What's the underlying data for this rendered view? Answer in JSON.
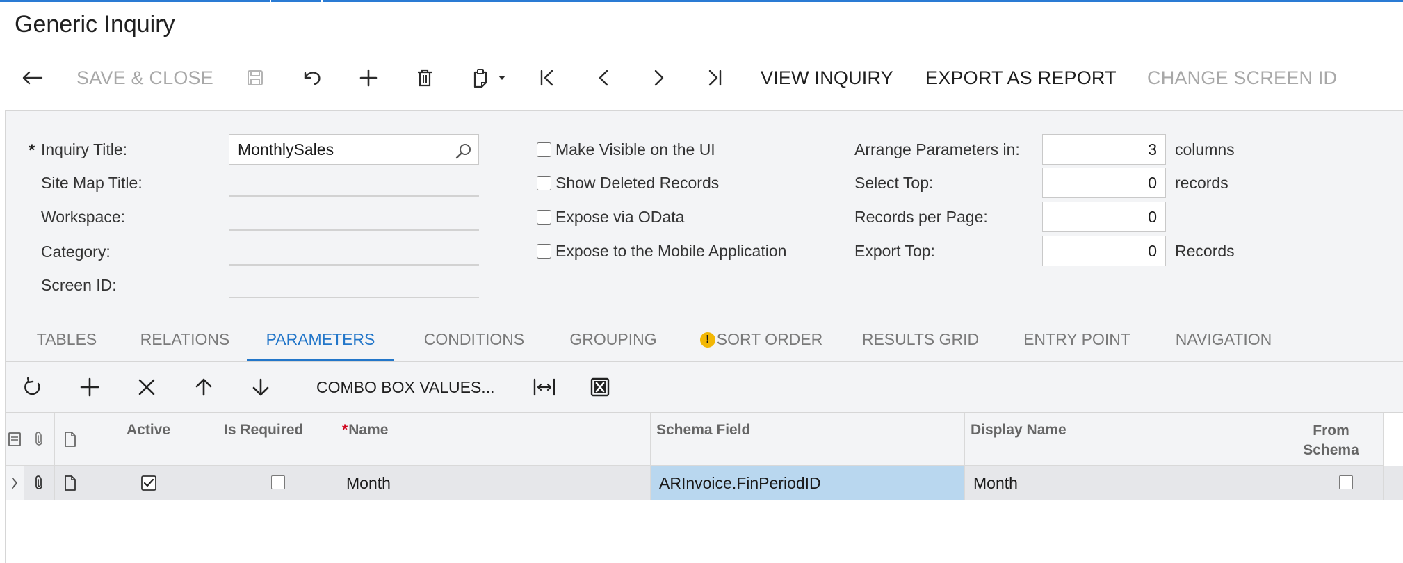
{
  "page": {
    "title": "Generic Inquiry"
  },
  "toolbar": {
    "back_icon": "back-arrow-icon",
    "save_close_label": "SAVE & CLOSE",
    "save_icon": "save-icon",
    "undo_icon": "undo-icon",
    "add_icon": "plus-icon",
    "delete_icon": "trash-icon",
    "clipboard_icon": "clipboard-icon",
    "first_icon": "first-page-icon",
    "prev_icon": "previous-icon",
    "next_icon": "next-icon",
    "last_icon": "last-page-icon",
    "view_inquiry_label": "VIEW INQUIRY",
    "export_report_label": "EXPORT AS REPORT",
    "change_screen_id_label": "CHANGE SCREEN ID"
  },
  "form": {
    "inquiry_title_label": "Inquiry Title:",
    "inquiry_title_required": "*",
    "inquiry_title_value": "MonthlySales",
    "site_map_title_label": "Site Map Title:",
    "workspace_label": "Workspace:",
    "category_label": "Category:",
    "screen_id_label": "Screen ID:",
    "make_visible_label": "Make Visible on the UI",
    "show_deleted_label": "Show Deleted Records",
    "expose_odata_label": "Expose via OData",
    "expose_mobile_label": "Expose to the Mobile Application",
    "arrange_params_label": "Arrange Parameters in:",
    "arrange_params_value": "3",
    "arrange_params_unit": "columns",
    "select_top_label": "Select Top:",
    "select_top_value": "0",
    "select_top_unit": "records",
    "records_per_page_label": "Records per Page:",
    "records_per_page_value": "0",
    "export_top_label": "Export Top:",
    "export_top_value": "0",
    "export_top_unit": "Records",
    "checkboxes": {
      "make_visible": false,
      "show_deleted": false,
      "expose_odata": false,
      "expose_mobile": false
    }
  },
  "tabs": {
    "tables": "TABLES",
    "relations": "RELATIONS",
    "parameters": "PARAMETERS",
    "conditions": "CONDITIONS",
    "grouping": "GROUPING",
    "sort_order": "SORT ORDER",
    "sort_order_warning": "!",
    "results_grid": "RESULTS GRID",
    "entry_point": "ENTRY POINT",
    "navigation": "NAVIGATION",
    "active": "PARAMETERS"
  },
  "grid_toolbar": {
    "refresh_icon": "refresh-icon",
    "add_icon": "plus-icon",
    "delete_icon": "close-icon",
    "up_icon": "arrow-up-icon",
    "down_icon": "arrow-down-icon",
    "combo_values_label": "COMBO BOX VALUES...",
    "fit_icon": "fit-columns-icon",
    "excel_icon": "excel-export-icon"
  },
  "grid": {
    "columns": {
      "active": "Active",
      "is_required": "Is Required",
      "name_star": "*",
      "name": "Name",
      "schema_field": "Schema Field",
      "display_name": "Display Name",
      "from_schema_1": "From",
      "from_schema_2": "Schema"
    },
    "rows": [
      {
        "active": true,
        "is_required": false,
        "name": "Month",
        "schema_field": "ARInvoice.FinPeriodID",
        "display_name": "Month",
        "from_schema": false
      }
    ]
  },
  "colors": {
    "accent": "#2276c9",
    "selected_cell": "#b9d7ef",
    "warning": "#f2b705",
    "required_star": "#d0021b"
  }
}
